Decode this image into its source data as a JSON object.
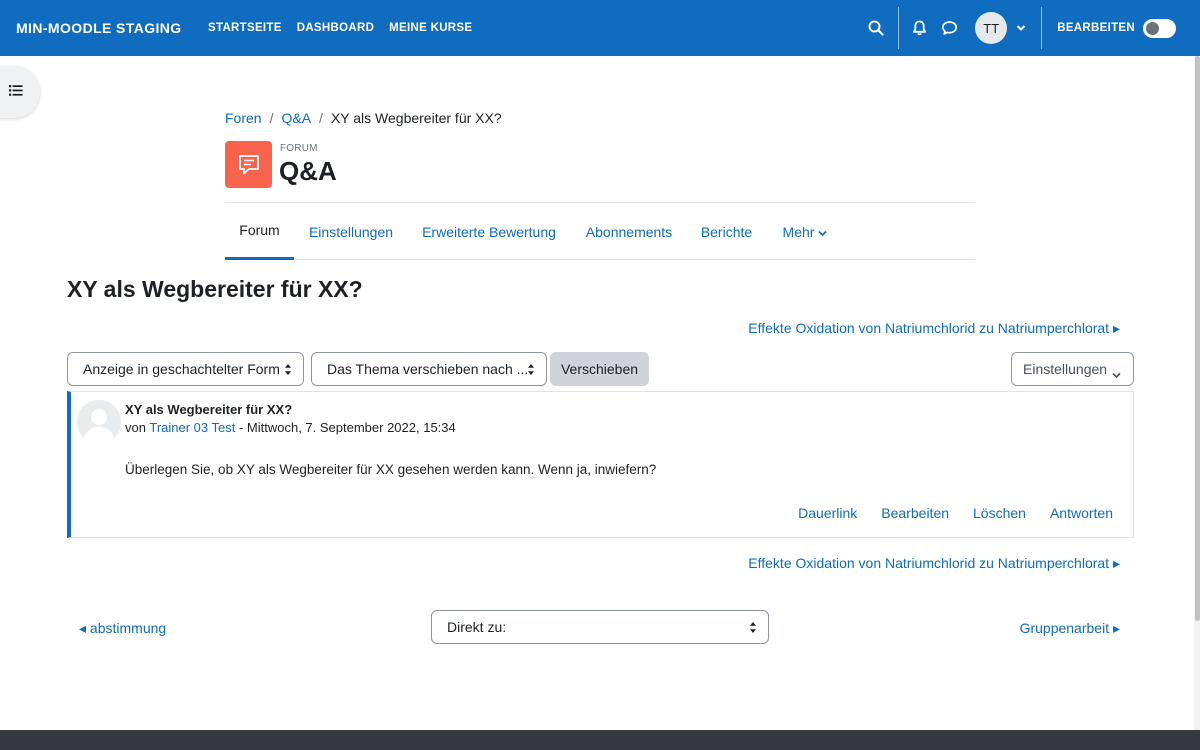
{
  "navbar": {
    "brand": "MIN-MOODLE STAGING",
    "links": [
      "STARTSEITE",
      "DASHBOARD",
      "MEINE KURSE"
    ],
    "avatar_initials": "TT",
    "edit_mode_label": "BEARBEITEN",
    "edit_mode_on": false
  },
  "breadcrumb": {
    "items": [
      "Foren",
      "Q&A",
      "XY als Wegbereiter für XX?"
    ]
  },
  "activity": {
    "type_label": "FORUM",
    "title": "Q&A",
    "icon_color": "#f7634d"
  },
  "secondary_nav": {
    "tabs": [
      "Forum",
      "Einstellungen",
      "Erweiterte Bewertung",
      "Abonnements",
      "Berichte",
      "Mehr"
    ],
    "active": "Forum"
  },
  "discussion": {
    "title": "XY als Wegbereiter für XX?",
    "next_link": "Effekte Oxidation von Natriumchlorid zu Natriumperchlorat ▸",
    "display_mode": "Anzeige in geschachtelter Form",
    "move_placeholder": "Das Thema verschieben nach ...",
    "move_button": "Verschieben",
    "settings_button": "Einstellungen"
  },
  "post": {
    "subject": "XY als Wegbereiter für XX?",
    "by_prefix": "von",
    "author": "Trainer 03 Test",
    "date": " - Mittwoch, 7. September 2022, 15:34",
    "message": "Überlegen Sie, ob XY als Wegbereiter für XX gesehen werden kann. Wenn ja, inwiefern?",
    "actions": [
      "Dauerlink",
      "Bearbeiten",
      "Löschen",
      "Antworten"
    ]
  },
  "activity_nav": {
    "prev": "◂ abstimmung",
    "jump_label": "Direkt zu:",
    "next": "Gruppenarbeit ▸"
  },
  "colors": {
    "primary": "#0f6cbf",
    "text": "#1d2125"
  }
}
